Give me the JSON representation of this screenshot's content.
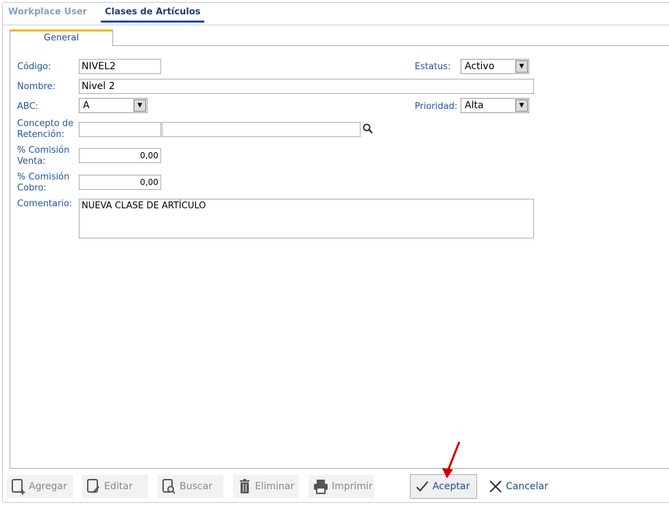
{
  "tabs": {
    "workplace": "Workplace User",
    "clases": "Clases de Artículos"
  },
  "subtab": "General",
  "form": {
    "codigo_label": "Código:",
    "codigo": "NIVEL2",
    "estatus_label": "Estatus:",
    "estatus": "Activo",
    "nombre_label": "Nombre:",
    "nombre": "Nivel 2",
    "abc_label": "ABC:",
    "abc": "A",
    "prioridad_label": "Prioridad:",
    "prioridad": "Alta",
    "concepto_label1": "Concepto de",
    "concepto_label2": "Retención:",
    "concepto_code": "",
    "concepto_desc": "",
    "com_venta_label1": "% Comisión",
    "com_venta_label2": "Venta:",
    "com_venta": "0,00",
    "com_cobro_label1": "% Comisión",
    "com_cobro_label2": "Cobro:",
    "com_cobro": "0,00",
    "comentario_label": "Comentario:",
    "comentario": "NUEVA CLASE DE ARTÍCULO"
  },
  "toolbar": {
    "agregar": "Agregar",
    "editar": "Editar",
    "buscar": "Buscar",
    "eliminar": "Eliminar",
    "imprimir": "Imprimir",
    "aceptar": "Aceptar",
    "cancelar": "Cancelar"
  }
}
